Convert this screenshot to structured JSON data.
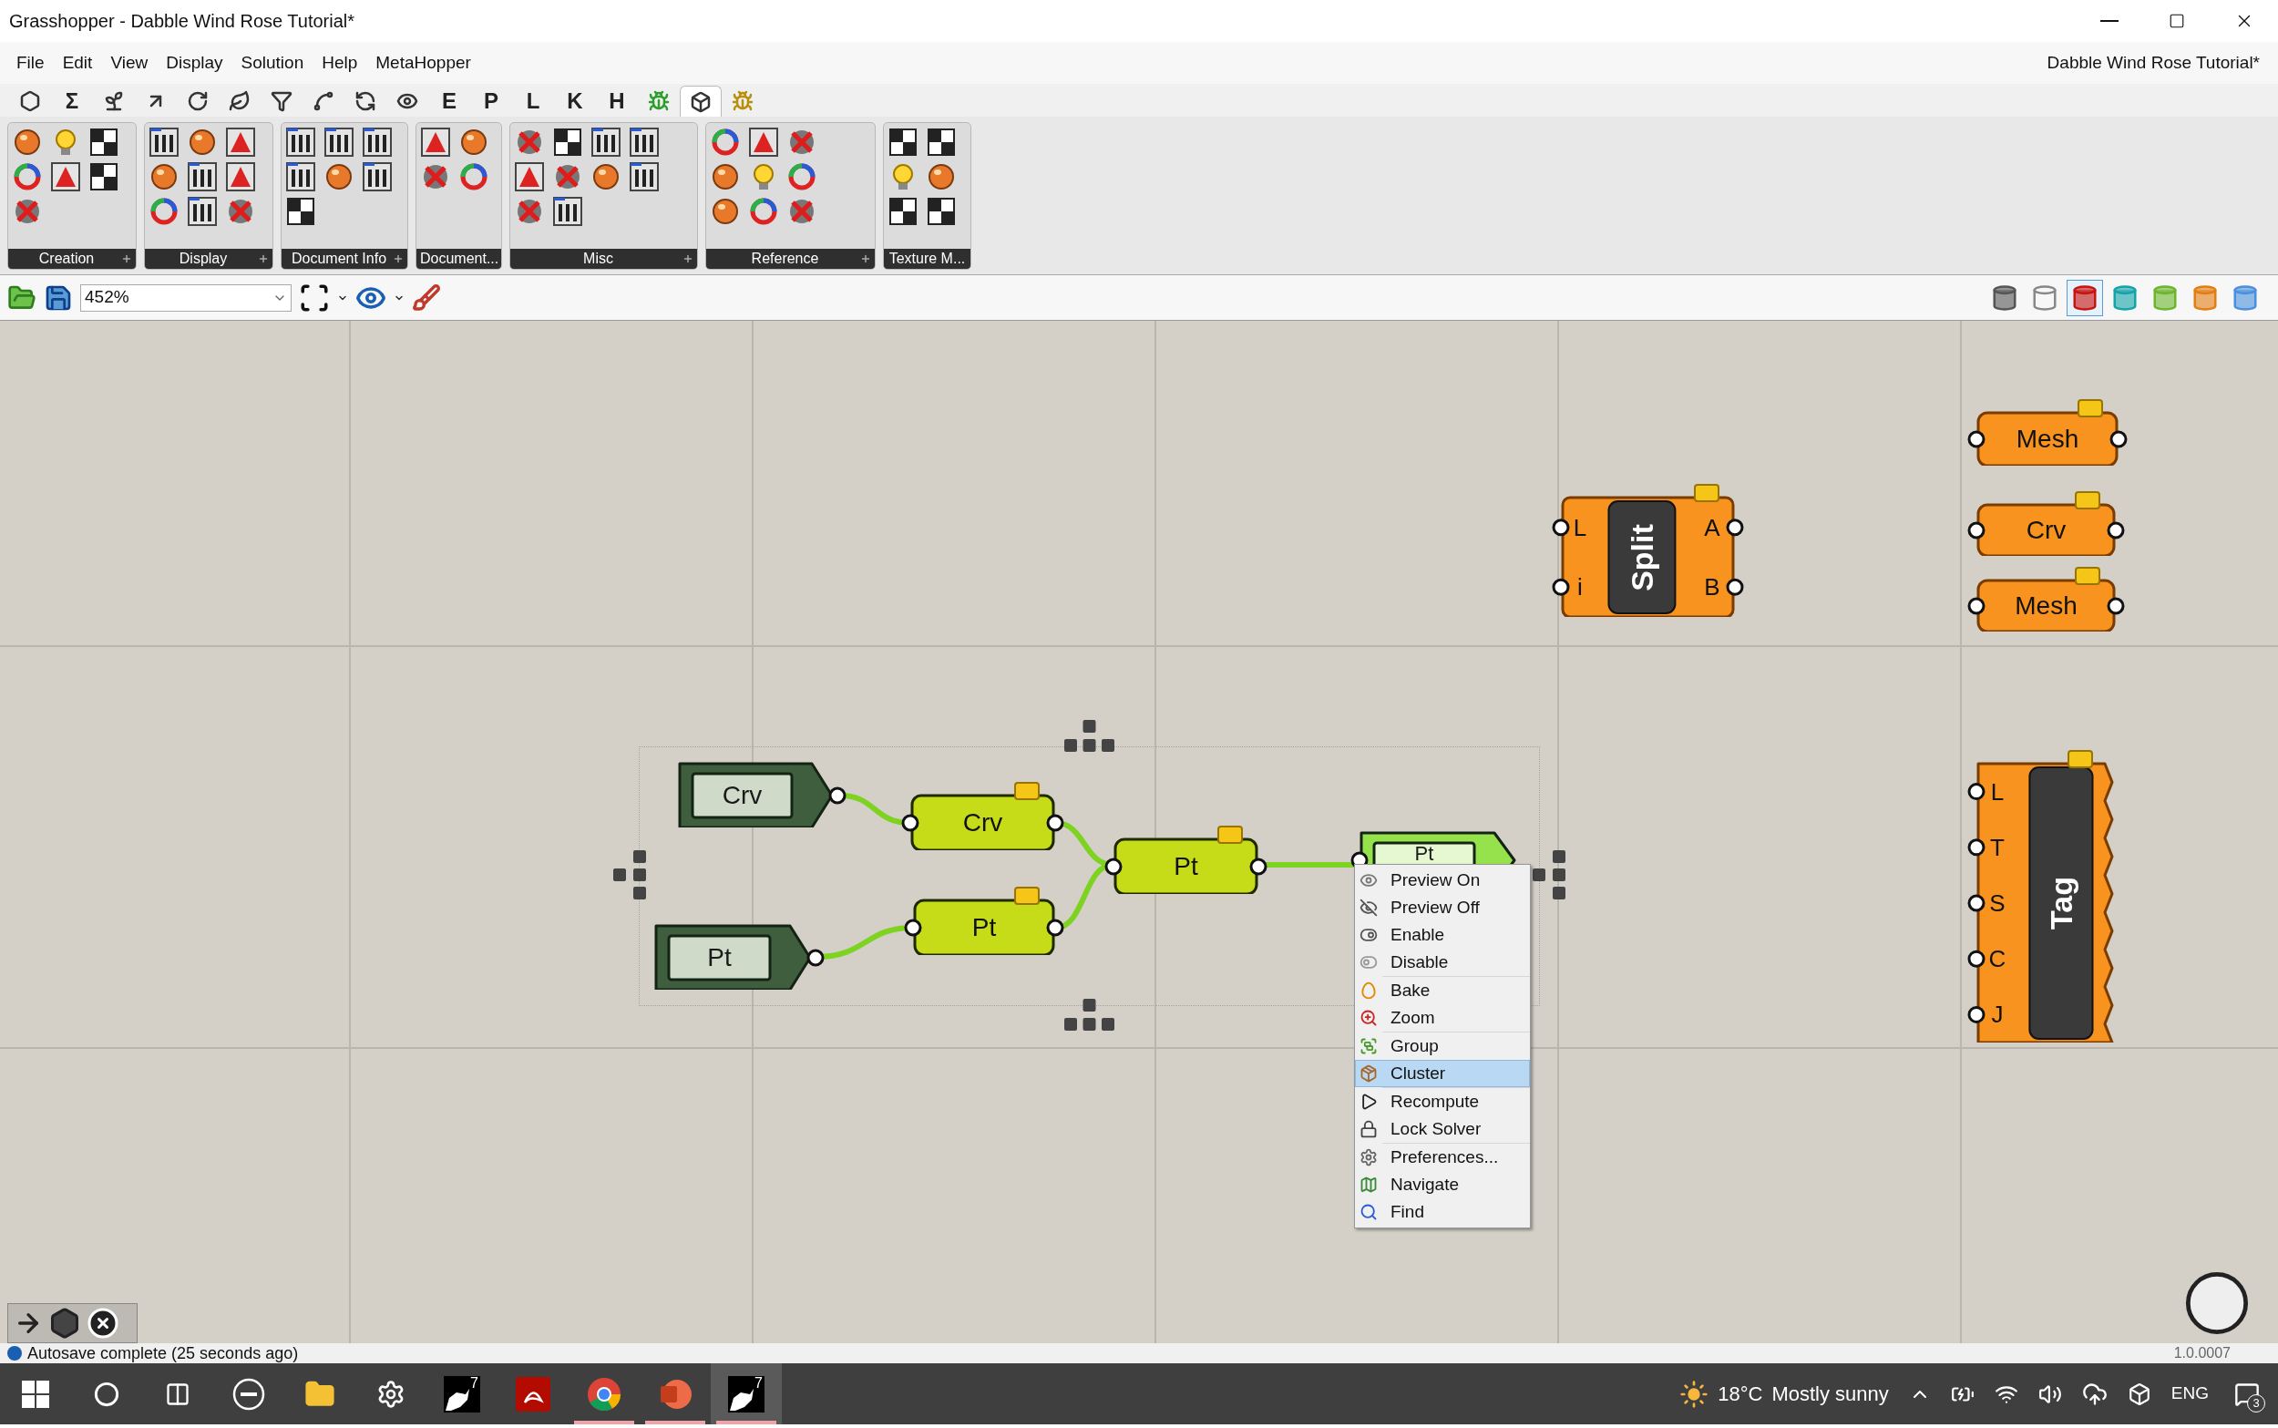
{
  "window": {
    "title": "Grasshopper - Dabble Wind Rose Tutorial*"
  },
  "menu": [
    "File",
    "Edit",
    "View",
    "Display",
    "Solution",
    "Help",
    "MetaHopper"
  ],
  "document_name": "Dabble Wind Rose Tutorial*",
  "tabs": [
    {
      "kind": "icon",
      "selected": false
    },
    {
      "kind": "letter",
      "label": "Σ",
      "selected": false
    },
    {
      "kind": "icon",
      "selected": false
    },
    {
      "kind": "icon",
      "selected": false
    },
    {
      "kind": "icon",
      "selected": false
    },
    {
      "kind": "icon",
      "selected": false
    },
    {
      "kind": "icon",
      "selected": false
    },
    {
      "kind": "icon",
      "selected": false
    },
    {
      "kind": "icon",
      "selected": false
    },
    {
      "kind": "icon",
      "selected": false
    },
    {
      "kind": "letter",
      "label": "E",
      "selected": false
    },
    {
      "kind": "letter",
      "label": "P",
      "selected": false
    },
    {
      "kind": "letter",
      "label": "L",
      "selected": false
    },
    {
      "kind": "letter",
      "label": "K",
      "selected": false
    },
    {
      "kind": "letter",
      "label": "H",
      "selected": false
    },
    {
      "kind": "icon",
      "selected": false
    },
    {
      "kind": "icon",
      "selected": true
    },
    {
      "kind": "icon",
      "selected": false
    }
  ],
  "ribbon": [
    {
      "label": "Creation",
      "expandable": true
    },
    {
      "label": "Display",
      "expandable": true
    },
    {
      "label": "Document Info",
      "expandable": true
    },
    {
      "label": "Document...",
      "expandable": false
    },
    {
      "label": "Misc",
      "expandable": true
    },
    {
      "label": "Reference",
      "expandable": true
    },
    {
      "label": "Texture M...",
      "expandable": false
    }
  ],
  "canvas_toolbar": {
    "zoom": "452%"
  },
  "display_modes": [
    {
      "selected": false
    },
    {
      "selected": false
    },
    {
      "selected": true
    },
    {
      "selected": false
    },
    {
      "selected": false
    },
    {
      "selected": false
    },
    {
      "selected": false
    }
  ],
  "canvas": {
    "nodes": [
      {
        "kind": "source",
        "label": "Crv",
        "flag": false
      },
      {
        "kind": "source",
        "label": "Pt",
        "flag": false
      },
      {
        "kind": "param",
        "label": "Crv",
        "flag": true
      },
      {
        "kind": "param",
        "label": "Pt",
        "flag": true
      },
      {
        "kind": "param",
        "label": "Pt",
        "flag": true
      },
      {
        "kind": "selected",
        "label": "Pt",
        "flag": false
      },
      {
        "kind": "component",
        "label": "Split",
        "inputs": [
          "L",
          "i"
        ],
        "outputs": [
          "A",
          "B"
        ],
        "flag": true
      },
      {
        "kind": "warning",
        "label": "Mesh",
        "flag": true
      },
      {
        "kind": "warning",
        "label": "Crv",
        "flag": true
      },
      {
        "kind": "warning",
        "label": "Mesh",
        "flag": true
      },
      {
        "kind": "component",
        "label": "Tag",
        "inputs": [
          "L",
          "T",
          "S",
          "C",
          "J"
        ],
        "flag": true
      }
    ],
    "context_menu": {
      "sections": [
        [
          {
            "label": "Preview On",
            "selected": false
          },
          {
            "label": "Preview Off",
            "selected": false
          },
          {
            "label": "Enable",
            "selected": false
          },
          {
            "label": "Disable",
            "selected": false
          }
        ],
        [
          {
            "label": "Bake",
            "selected": false
          },
          {
            "label": "Zoom",
            "selected": false
          }
        ],
        [
          {
            "label": "Group",
            "selected": false
          },
          {
            "label": "Cluster",
            "selected": true
          }
        ],
        [
          {
            "label": "Recompute",
            "selected": false
          },
          {
            "label": "Lock Solver",
            "selected": false
          }
        ],
        [
          {
            "label": "Preferences...",
            "selected": false
          },
          {
            "label": "Navigate",
            "selected": false
          },
          {
            "label": "Find",
            "selected": false
          }
        ]
      ]
    }
  },
  "status_bar": {
    "message": "Autosave complete (25 seconds ago)",
    "version": "1.0.0007"
  },
  "taskbar": {
    "apps": [
      {
        "kind": "windows",
        "running": false,
        "active": false
      },
      {
        "kind": "search",
        "running": false,
        "active": false
      },
      {
        "kind": "taskview",
        "running": false,
        "active": false
      },
      {
        "kind": "dell",
        "running": false,
        "active": false
      },
      {
        "kind": "explorer",
        "running": false,
        "active": false
      },
      {
        "kind": "settings",
        "running": false,
        "active": false
      },
      {
        "kind": "rhino",
        "badge": "7",
        "running": false,
        "active": false
      },
      {
        "kind": "acrobat",
        "running": false,
        "active": false
      },
      {
        "kind": "chrome",
        "running": true,
        "active": false
      },
      {
        "kind": "powerpoint",
        "running": true,
        "active": false
      },
      {
        "kind": "rhino",
        "badge": "7",
        "running": true,
        "active": true
      }
    ],
    "temperature": "18°C",
    "weather": "Mostly sunny",
    "language": "ENG",
    "notifications": "3"
  }
}
